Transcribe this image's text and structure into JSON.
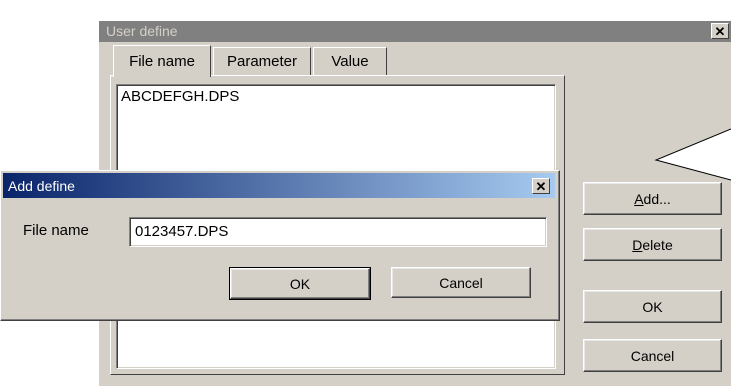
{
  "user_define": {
    "title": "User define",
    "tabs": [
      "File name",
      "Parameter",
      "Value"
    ],
    "list_items": [
      "ABCDEFGH.DPS"
    ],
    "buttons": {
      "add_accel": "A",
      "add_rest": "dd...",
      "delete_accel": "D",
      "delete_rest": "elete",
      "ok": "OK",
      "cancel": "Cancel"
    }
  },
  "add_define": {
    "title": "Add define",
    "field_label": "File name",
    "field_value": "0123457.DPS",
    "ok": "OK",
    "cancel": "Cancel"
  },
  "colors": {
    "face": "#d4d0c8",
    "active_title_start": "#0a246a",
    "active_title_end": "#a6caf0",
    "inactive_title": "#808080"
  }
}
